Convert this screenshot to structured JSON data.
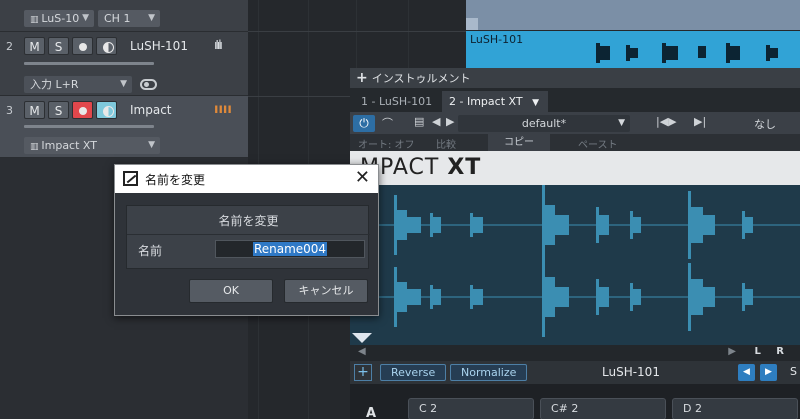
{
  "tracks": {
    "top": {
      "input_label": "LuS-10",
      "channel": "CH 1"
    },
    "track2": {
      "number": "2",
      "mute": "M",
      "solo": "S",
      "name": "LuSH-101",
      "input": "入力 L+R"
    },
    "track3": {
      "number": "3",
      "mute": "M",
      "solo": "S",
      "name": "Impact",
      "instrument": "Impact XT"
    }
  },
  "arranger": {
    "clip_name": "LuSH-101"
  },
  "instrument_window": {
    "title": "インストゥルメント",
    "tabs": [
      "1 - LuSH-101",
      "2 - Impact XT"
    ],
    "preset": "default*",
    "preset_b": "なし",
    "auto_label": "オート: オフ",
    "compare": "比較",
    "copy": "コピー",
    "paste": "ペースト",
    "plugin_title_left": "MPACT",
    "plugin_title_right": "XT",
    "lr_label": "L R",
    "reverse": "Reverse",
    "normalize": "Normalize",
    "sample_name": "LuSH-101",
    "truncated": "S",
    "pad_bank": "A",
    "pads": [
      "C 2",
      "C# 2",
      "D 2"
    ]
  },
  "dialog": {
    "title": "名前を変更",
    "group_title": "名前を変更",
    "name_label": "名前",
    "name_value": "Rename004",
    "ok": "OK",
    "cancel": "キャンセル"
  },
  "colors": {
    "record": "#e1474c",
    "monitor": "#7fc9dc",
    "clip": "#31a3d6",
    "accent_blue": "#2d6ea4",
    "selection": "#2f79c6"
  }
}
